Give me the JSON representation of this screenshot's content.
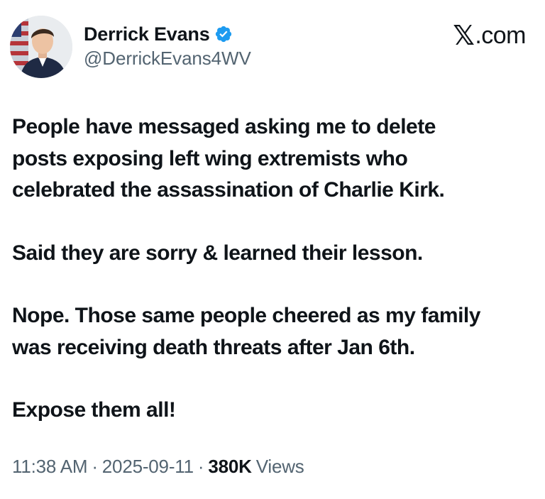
{
  "author": {
    "display_name": "Derrick Evans",
    "handle": "@DerrickEvans4WV",
    "verified": true,
    "avatar": "profile-photo"
  },
  "brand": {
    "label": ".com",
    "logo_glyph": "𝕏"
  },
  "tweet": {
    "paragraphs": [
      "People have messaged asking me to delete\nposts exposing left wing extremists who\ncelebrated the assassination of Charlie Kirk.",
      "Said they are sorry & learned their lesson.",
      "Nope. Those same people cheered as my family\nwas receiving death threats after Jan 6th.",
      "Expose them all!"
    ]
  },
  "meta": {
    "time": "11:38 AM",
    "separator": "·",
    "date": "2025-09-11",
    "views_count": "380K",
    "views_label": "Views"
  },
  "colors": {
    "text": "#0f1419",
    "secondary": "#536471",
    "verified_badge": "#1d9bf0"
  }
}
